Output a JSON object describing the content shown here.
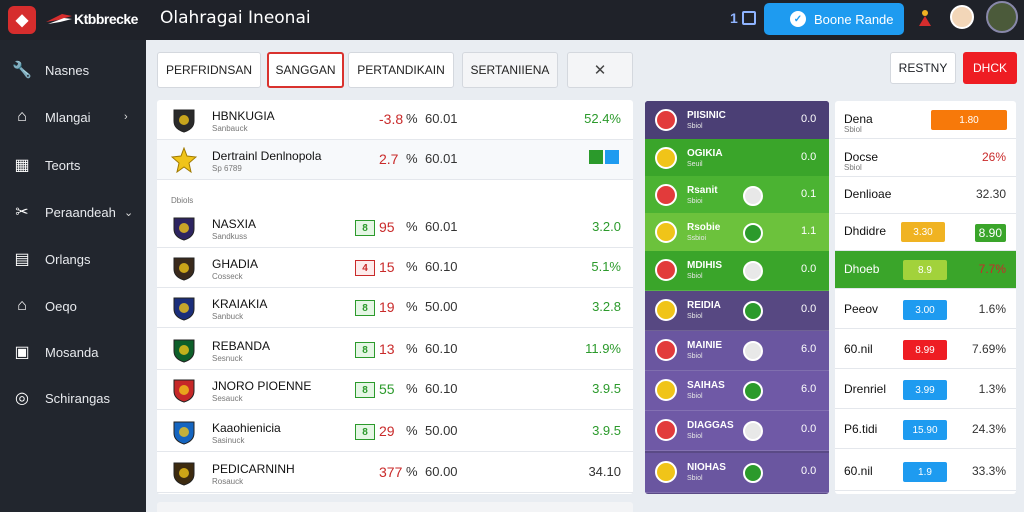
{
  "header": {
    "brand": "Ktbbrecke",
    "title": "Olahragai Ineonai",
    "counter": "1",
    "cta_label": "Boone Rande"
  },
  "sidebar": {
    "items": [
      {
        "label": "Nasnes",
        "icon": "wrench-icon",
        "chevron": false
      },
      {
        "label": "Mlangai",
        "icon": "home-icon",
        "chevron": true
      },
      {
        "label": "Teorts",
        "icon": "table-icon",
        "chevron": false
      },
      {
        "label": "Peraandeah",
        "icon": "tools-icon",
        "chevron": true
      },
      {
        "label": "Orlangs",
        "icon": "basket-icon",
        "chevron": false
      },
      {
        "label": "Oeqo",
        "icon": "house-icon",
        "chevron": false
      },
      {
        "label": "Mosanda",
        "icon": "calendar-icon",
        "chevron": false
      },
      {
        "label": "Schirangas",
        "icon": "refresh-icon",
        "chevron": false
      }
    ]
  },
  "tabs": [
    "PERFRIDNSAN",
    "SANGGAN",
    "PERTANDIKAIN",
    "SERTANIIENA",
    "✕"
  ],
  "actions": {
    "reset": "RESTNY",
    "check": "DHCK"
  },
  "section_label": "Dbiols",
  "table_rows": [
    {
      "name": "HBNKUGIA",
      "sub": "Sanbauck",
      "badge": "",
      "val": "-3.8",
      "pct": "%",
      "num": "60.01",
      "end": "52.4%",
      "end_color": "#2b9a2b",
      "val_color": "#c92a2a"
    },
    {
      "name": "Dertrainl Denlnopola",
      "sub": "Sp 6789",
      "badge": "",
      "val": "2.7",
      "pct": "%",
      "num": "60.01",
      "end": "",
      "end_color": "#2b9a2b",
      "val_color": "#c92a2a"
    },
    {
      "name": "NASXIA",
      "sub": "Sandkuss",
      "badge": "8",
      "val": "95",
      "pct": "%",
      "num": "60.01",
      "end": "3.2.0",
      "end_color": "#2b9a2b",
      "val_color": "#c92a2a"
    },
    {
      "name": "GHADIA",
      "sub": "Cosseck",
      "badge": "4",
      "val": "15",
      "pct": "%",
      "num": "60.10",
      "end": "5.1%",
      "end_color": "#2b9a2b",
      "val_color": "#c92a2a"
    },
    {
      "name": "KRAIAKIA",
      "sub": "Sanbuck",
      "badge": "8",
      "val": "19",
      "pct": "%",
      "num": "50.00",
      "end": "3.2.8",
      "end_color": "#2b9a2b",
      "val_color": "#c92a2a"
    },
    {
      "name": "REBANDA",
      "sub": "Sesnuck",
      "badge": "8",
      "val": "13",
      "pct": "%",
      "num": "60.10",
      "end": "11.9%",
      "end_color": "#2b9a2b",
      "val_color": "#c92a2a"
    },
    {
      "name": "JNORO PIOENNE",
      "sub": "Sesauck",
      "badge": "8",
      "val": "55",
      "pct": "%",
      "num": "60.10",
      "end": "3.9.5",
      "end_color": "#2b9a2b",
      "val_color": "#2b9a2b"
    },
    {
      "name": "Kaaohienicia",
      "sub": "Sasinuck",
      "badge": "8",
      "val": "29",
      "pct": "%",
      "num": "50.00",
      "end": "3.9.5",
      "end_color": "#2b9a2b",
      "val_color": "#c92a2a"
    },
    {
      "name": "PEDICARNINH",
      "sub": "Rosauck",
      "badge": "",
      "val": "377",
      "pct": "%",
      "num": "60.00",
      "end": "34.10",
      "end_color": "#333333",
      "val_color": "#c92a2a"
    }
  ],
  "matchups": [
    {
      "name": "PIISINIC",
      "sub": "Sbiol",
      "score": "0.0",
      "bg": "#4b3f75"
    },
    {
      "name": "OGIKIA",
      "sub": "Seuil",
      "score": "0.0",
      "bg": "#3aa52a"
    },
    {
      "name": "Rsanit",
      "sub": "Sbioi",
      "score": "0.1",
      "bg": "#4bb332"
    },
    {
      "name": "Rsobie",
      "sub": "Ssbioi",
      "score": "1.1",
      "bg": "#6cc23c"
    },
    {
      "name": "MDIHIS",
      "sub": "Sbiol",
      "score": "0.0",
      "bg": "#3aa52a"
    },
    {
      "name": "REIDIA",
      "sub": "Sbiol",
      "score": "0.0",
      "bg": "#574882"
    },
    {
      "name": "MAINIE",
      "sub": "Sbiol",
      "score": "6.0",
      "bg": "#6a56a0"
    },
    {
      "name": "SAIHAS",
      "sub": "Sbiol",
      "score": "6.0",
      "bg": "#6f59a6"
    },
    {
      "name": "DIAGGAS",
      "sub": "Sbiol",
      "score": "0.0",
      "bg": "#6f59a6"
    },
    {
      "name": "NIOHAS",
      "sub": "Sbiol",
      "score": "0.0",
      "bg": "#6a56a0"
    }
  ],
  "odds": [
    {
      "name": "Dena",
      "sub": "Sbiol",
      "chip": "1.80",
      "chip_color": "#f7790a",
      "val": "",
      "val_color": "#333"
    },
    {
      "name": "Docse",
      "sub": "Sbiol",
      "chip": "",
      "chip_color": "",
      "val": "26%",
      "val_color": "#c92a2a"
    },
    {
      "name": "Denlioae",
      "sub": "",
      "chip": "",
      "chip_color": "",
      "val": "32.30",
      "val_color": "#333"
    },
    {
      "name": "Dhdidre",
      "sub": "",
      "chip": "3.30",
      "chip_color": "#f0b322",
      "val": "8.90",
      "val_color": "#fff"
    },
    {
      "name": "Dhoeb",
      "sub": "",
      "chip": "8.9",
      "chip_color": "#a2d23b",
      "val": "7.7%",
      "val_color": "#c92a2a"
    },
    {
      "name": "Peeov",
      "sub": "",
      "chip": "3.00",
      "chip_color": "#1e9bf0",
      "val": "1.6%",
      "val_color": "#333"
    },
    {
      "name": "60.nil",
      "sub": "",
      "chip": "8.99",
      "chip_color": "#ee1d23",
      "val": "7.69%",
      "val_color": "#333"
    },
    {
      "name": "Drenriel",
      "sub": "",
      "chip": "3.99",
      "chip_color": "#1e9bf0",
      "val": "1.3%",
      "val_color": "#333"
    },
    {
      "name": "P6.tidi",
      "sub": "",
      "chip": "15.90",
      "chip_color": "#1e9bf0",
      "val": "24.3%",
      "val_color": "#333"
    },
    {
      "name": "60.nil",
      "sub": "",
      "chip": "1.9",
      "chip_color": "#1e9bf0",
      "val": "33.3%",
      "val_color": "#333"
    }
  ]
}
